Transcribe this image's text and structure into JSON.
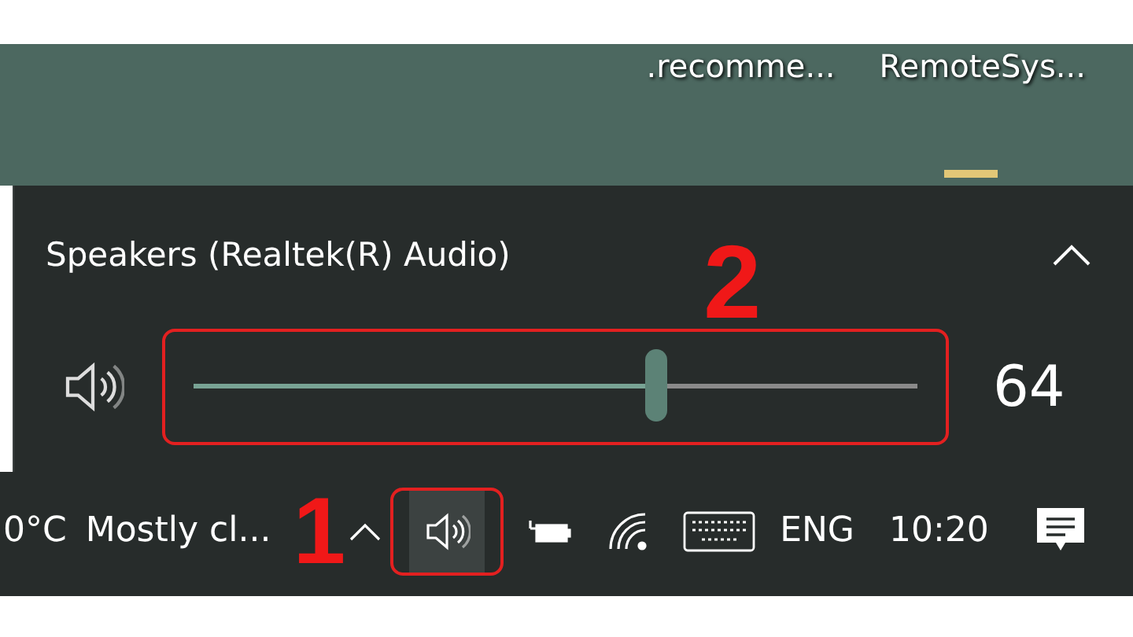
{
  "desktop": {
    "icon_labels": [
      ".recomme...",
      "RemoteSys..."
    ]
  },
  "volume_flyout": {
    "device": "Speakers (Realtek(R) Audio)",
    "expanded": true,
    "volume": {
      "level": 0.64,
      "reading": "64"
    }
  },
  "taskbar": {
    "temperature": "0°C",
    "weather": "Mostly cl...",
    "language": "ENG",
    "time": "10:20"
  },
  "annotations": [
    {
      "label": "2"
    },
    {
      "label": "1"
    }
  ]
}
